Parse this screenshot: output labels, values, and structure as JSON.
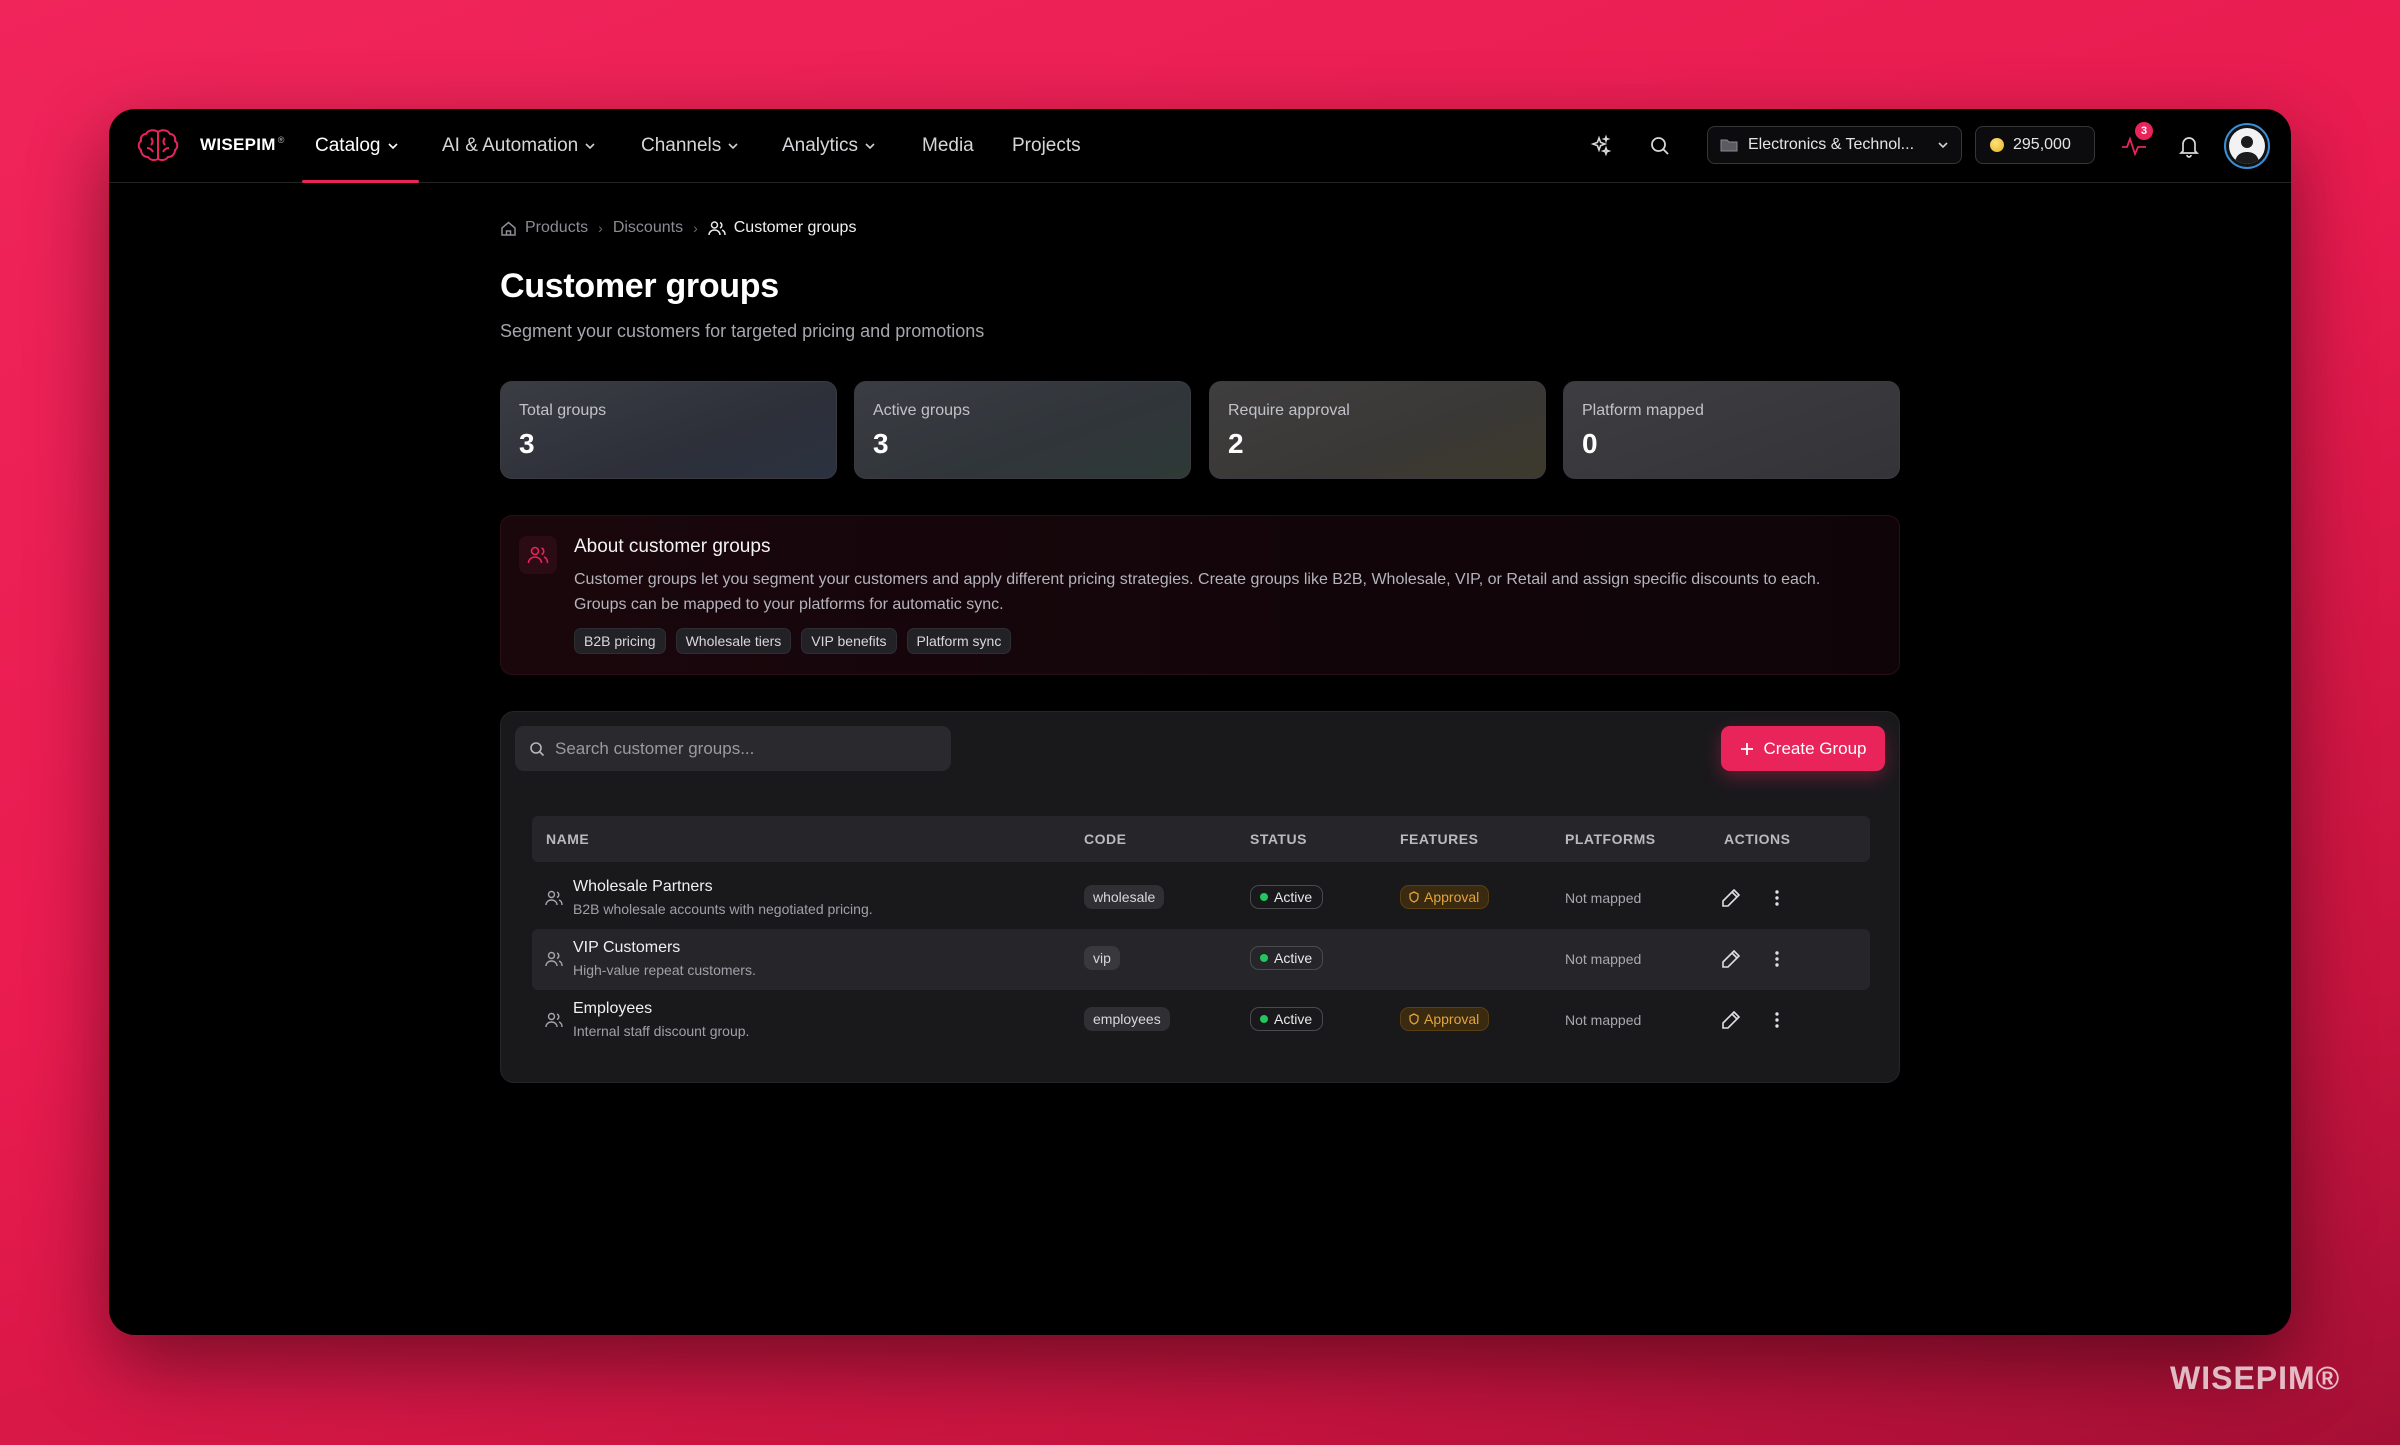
{
  "app": {
    "brand": "WISEPIM",
    "brand_mark": "®",
    "watermark": "WISEPIM®"
  },
  "nav": {
    "items": [
      {
        "label": "Catalog",
        "dropdown": true,
        "active": true
      },
      {
        "label": "AI & Automation",
        "dropdown": true
      },
      {
        "label": "Channels",
        "dropdown": true
      },
      {
        "label": "Analytics",
        "dropdown": true
      },
      {
        "label": "Media",
        "dropdown": false
      },
      {
        "label": "Projects",
        "dropdown": false
      }
    ],
    "workspace": "Electronics & Technol...",
    "credits": "295,000",
    "activity_badge": "3",
    "icons": [
      "sparkles-icon",
      "search-icon",
      "activity-icon",
      "bell-icon",
      "user-avatar"
    ]
  },
  "breadcrumb": {
    "items": [
      "Products",
      "Discounts",
      "Customer groups"
    ]
  },
  "page": {
    "title": "Customer groups",
    "subtitle": "Segment your customers for targeted pricing and promotions"
  },
  "stats": [
    {
      "label": "Total groups",
      "value": "3"
    },
    {
      "label": "Active groups",
      "value": "3"
    },
    {
      "label": "Require approval",
      "value": "2"
    },
    {
      "label": "Platform mapped",
      "value": "0"
    }
  ],
  "about": {
    "title": "About customer groups",
    "text": "Customer groups let you segment your customers and apply different pricing strategies. Create groups like B2B, Wholesale, VIP, or Retail and assign specific discounts to each. Groups can be mapped to your platforms for automatic sync.",
    "chips": [
      "B2B pricing",
      "Wholesale tiers",
      "VIP benefits",
      "Platform sync"
    ]
  },
  "table": {
    "search_placeholder": "Search customer groups...",
    "create_label": "Create Group",
    "headers": [
      "NAME",
      "CODE",
      "STATUS",
      "FEATURES",
      "PLATFORMS",
      "ACTIONS"
    ],
    "rows": [
      {
        "name": "Wholesale Partners",
        "desc": "B2B wholesale accounts with negotiated pricing.",
        "code": "wholesale",
        "status": "Active",
        "feature": "Approval",
        "platforms": "Not mapped"
      },
      {
        "name": "VIP Customers",
        "desc": "High-value repeat customers.",
        "code": "vip",
        "status": "Active",
        "feature": "",
        "platforms": "Not mapped"
      },
      {
        "name": "Employees",
        "desc": "Internal staff discount group.",
        "code": "employees",
        "status": "Active",
        "feature": "Approval",
        "platforms": "Not mapped"
      }
    ]
  },
  "colors": {
    "accent": "#e8245a",
    "status_active": "#22c55e",
    "approval": "#e5a33b"
  }
}
